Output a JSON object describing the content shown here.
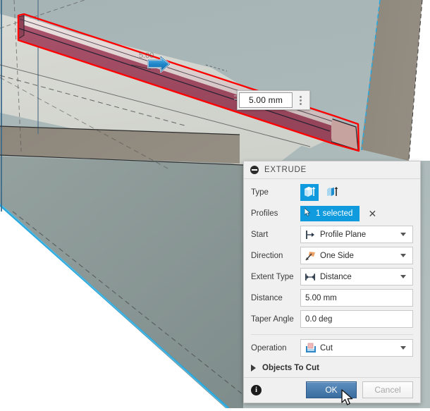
{
  "app": {
    "canvas_background": "#ffffff"
  },
  "canvas": {
    "manipulator": {
      "name": "distance-manipulator",
      "value": "5.00 mm",
      "menu_icon": "vertical-dots-icon",
      "arrow_icon": "blue-drag-arrow-icon"
    },
    "colors": {
      "sky_face": "#a9b6b8",
      "light_face": "#d7d8d2",
      "tan_face": "#8d867b",
      "body_face": "#8d9b99",
      "selection_fill": "#a44a63",
      "selection_outline": "#ff0000",
      "edge_highlight": "#29a8dd"
    }
  },
  "dialog": {
    "title": "EXTRUDE",
    "collapse_icon": "minus-circle-icon",
    "rows": {
      "type": {
        "label": "Type",
        "options": [
          {
            "name": "profile-extrude-icon",
            "selected": true
          },
          {
            "name": "surface-extrude-icon",
            "selected": false
          }
        ]
      },
      "profiles": {
        "label": "Profiles",
        "chip_icon": "selection-cursor-icon",
        "chip_text": "1 selected",
        "clear_icon": "close-x-icon"
      },
      "start": {
        "label": "Start",
        "icon": "profile-plane-icon",
        "value": "Profile Plane"
      },
      "direction": {
        "label": "Direction",
        "icon": "one-side-arrow-icon",
        "value": "One Side"
      },
      "extent_type": {
        "label": "Extent Type",
        "icon": "distance-measure-icon",
        "value": "Distance"
      },
      "distance": {
        "label": "Distance",
        "value": "5.00 mm"
      },
      "taper_angle": {
        "label": "Taper Angle",
        "value": "0.0 deg"
      },
      "operation": {
        "label": "Operation",
        "icon": "cut-operation-icon",
        "value": "Cut"
      }
    },
    "expander": {
      "label": "Objects To Cut",
      "icon": "triangle-right-icon",
      "expanded": false
    },
    "footer": {
      "info_icon": "info-icon",
      "ok_label": "OK",
      "cancel_label": "Cancel"
    },
    "accent_color": "#0f9bdd",
    "ok_color": "#3a6d9f"
  }
}
